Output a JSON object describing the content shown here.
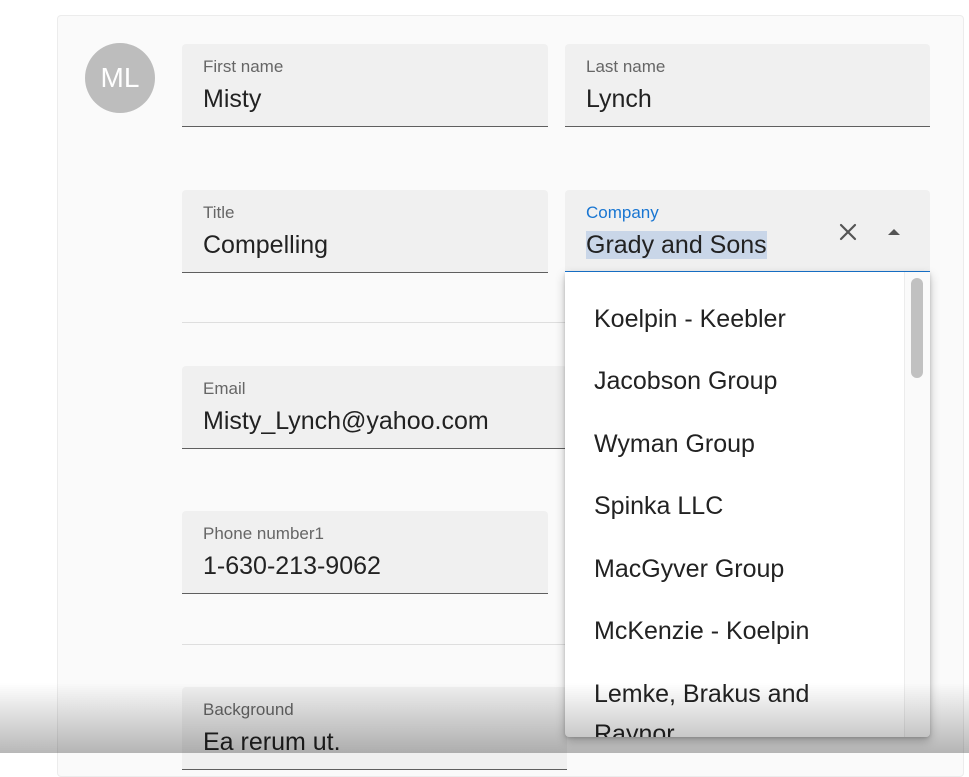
{
  "avatar": {
    "initials": "ML"
  },
  "fields": {
    "first_name": {
      "label": "First name",
      "value": "Misty"
    },
    "last_name": {
      "label": "Last name",
      "value": "Lynch"
    },
    "title": {
      "label": "Title",
      "value": "Compelling"
    },
    "company": {
      "label": "Company",
      "value": "Grady and Sons"
    },
    "email": {
      "label": "Email",
      "value": "Misty_Lynch@yahoo.com"
    },
    "phone": {
      "label": "Phone number1",
      "value": "1-630-213-9062"
    },
    "background": {
      "label": "Background",
      "value": "Ea rerum ut."
    }
  },
  "company_dropdown": {
    "options": [
      "Koelpin - Keebler",
      "Jacobson Group",
      "Wyman Group",
      "Spinka LLC",
      "MacGyver Group",
      "McKenzie - Koelpin",
      "Lemke, Brakus and",
      "Raynor"
    ]
  },
  "icons": {
    "clear": "close-icon",
    "toggle": "arrow-up-icon"
  },
  "colors": {
    "accent": "#1976d2",
    "avatar_bg": "#bdbdbd",
    "selection": "#c9d6e8"
  }
}
